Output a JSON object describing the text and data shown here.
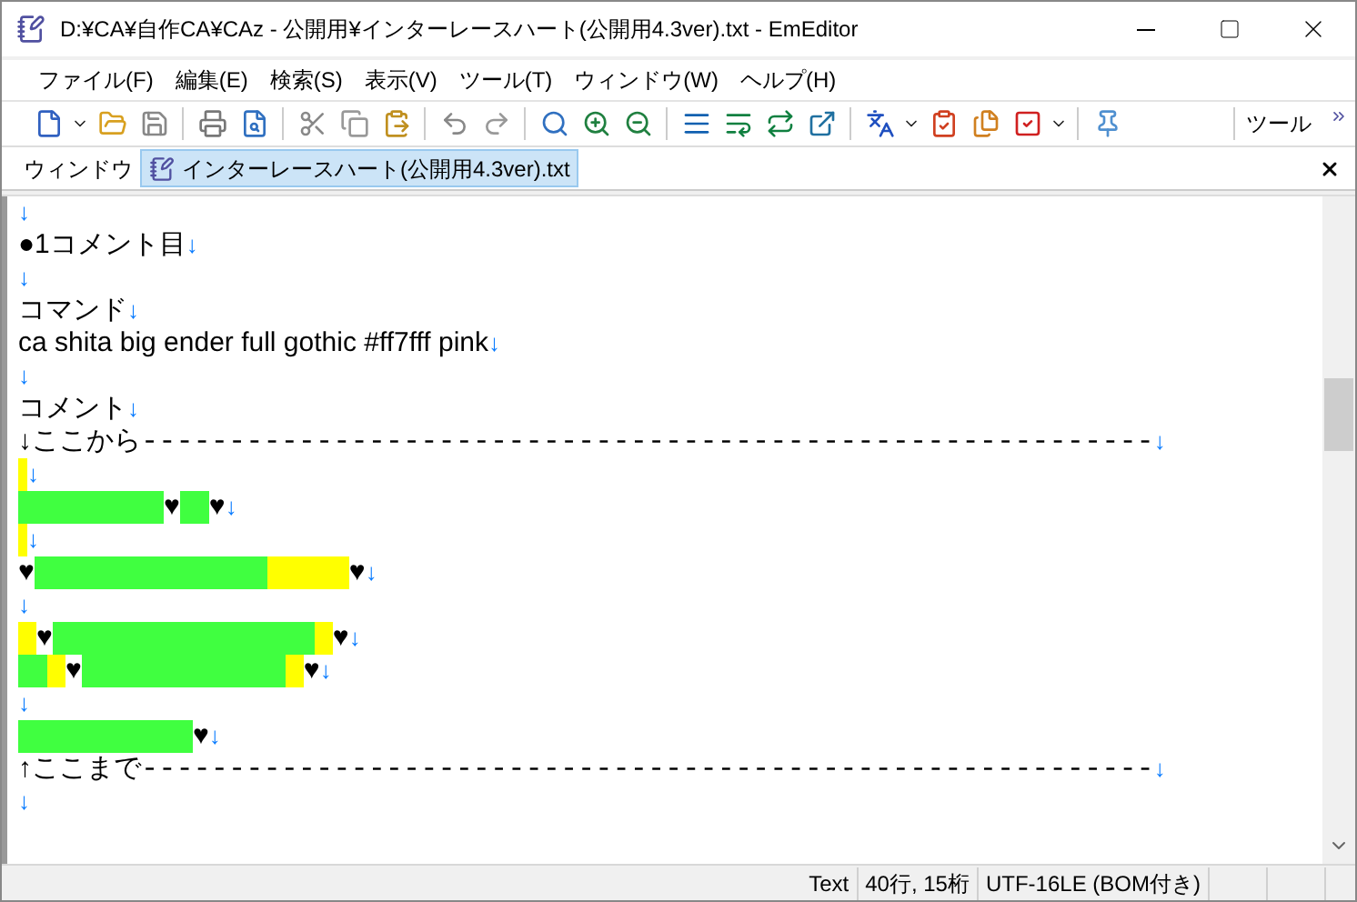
{
  "window": {
    "title": "D:¥CA¥自作CA¥CAz - 公開用¥インターレースハート(公開用4.3ver).txt - EmEditor"
  },
  "menu": [
    "ファイル(F)",
    "編集(E)",
    "検索(S)",
    "表示(V)",
    "ツール(T)",
    "ウィンドウ(W)",
    "ヘルプ(H)"
  ],
  "toolbar": {
    "overflow_label": "ツール"
  },
  "tabbar": {
    "label": "ウィンドウ",
    "tabs": [
      {
        "label": "インターレースハート(公開用4.3ver).txt",
        "selected": true
      }
    ]
  },
  "lines": [
    {
      "segments": [
        {
          "kind": "eol",
          "text": "↓"
        }
      ]
    },
    {
      "segments": [
        {
          "kind": "text",
          "text": "●1コメント目"
        },
        {
          "kind": "eol",
          "text": "↓"
        }
      ]
    },
    {
      "segments": [
        {
          "kind": "eol",
          "text": "↓"
        }
      ]
    },
    {
      "segments": [
        {
          "kind": "text",
          "text": "コマンド"
        },
        {
          "kind": "eol",
          "text": "↓"
        }
      ]
    },
    {
      "segments": [
        {
          "kind": "text",
          "text": "ca shita big ender full gothic #ff7fff pink"
        },
        {
          "kind": "eol",
          "text": "↓"
        }
      ]
    },
    {
      "segments": [
        {
          "kind": "eol",
          "text": "↓"
        }
      ]
    },
    {
      "segments": [
        {
          "kind": "text",
          "text": "コメント"
        },
        {
          "kind": "eol",
          "text": "↓"
        }
      ]
    },
    {
      "segments": [
        {
          "kind": "text",
          "text": "↓ここから"
        },
        {
          "kind": "rule",
          "text": "----------------------------------------------------------"
        },
        {
          "kind": "eol",
          "text": "↓"
        }
      ]
    },
    {
      "segments": [
        {
          "kind": "fill",
          "color": "#ffff00"
        },
        {
          "kind": "eol",
          "text": "↓"
        }
      ]
    },
    {
      "segments": [
        {
          "kind": "fill",
          "color": "#40ff40"
        },
        {
          "kind": "text",
          "text": "♥"
        },
        {
          "kind": "fill",
          "color": "#40ff40"
        },
        {
          "kind": "text",
          "text": "♥"
        },
        {
          "kind": "eol",
          "text": "↓"
        }
      ]
    },
    {
      "segments": [
        {
          "kind": "fill",
          "color": "#ffff00"
        },
        {
          "kind": "eol",
          "text": "↓"
        }
      ]
    },
    {
      "segments": [
        {
          "kind": "text",
          "text": "♥"
        },
        {
          "kind": "fill",
          "color": "#40ff40"
        },
        {
          "kind": "fill",
          "color": "#ffff00"
        },
        {
          "kind": "text",
          "text": "♥"
        },
        {
          "kind": "eol",
          "text": "↓"
        }
      ]
    },
    {
      "segments": [
        {
          "kind": "eol",
          "text": "↓"
        }
      ]
    },
    {
      "segments": [
        {
          "kind": "fill",
          "color": "#ffff00"
        },
        {
          "kind": "text",
          "text": "♥"
        },
        {
          "kind": "fill",
          "color": "#40ff40"
        },
        {
          "kind": "fill",
          "color": "#ffff00"
        },
        {
          "kind": "text",
          "text": "♥"
        },
        {
          "kind": "eol",
          "text": "↓"
        }
      ]
    },
    {
      "segments": [
        {
          "kind": "fill",
          "color": "#40ff40"
        },
        {
          "kind": "fill",
          "color": "#ffff00"
        },
        {
          "kind": "text",
          "text": "♥"
        },
        {
          "kind": "fill",
          "color": "#40ff40"
        },
        {
          "kind": "fill",
          "color": "#ffff00"
        },
        {
          "kind": "text",
          "text": "♥"
        },
        {
          "kind": "eol",
          "text": "↓"
        }
      ]
    },
    {
      "segments": [
        {
          "kind": "eol",
          "text": "↓"
        }
      ]
    },
    {
      "segments": [
        {
          "kind": "fill",
          "color": "#40ff40"
        },
        {
          "kind": "text",
          "text": "♥"
        },
        {
          "kind": "eol",
          "text": "↓"
        }
      ]
    },
    {
      "segments": [
        {
          "kind": "text",
          "text": "↑ここまで"
        },
        {
          "kind": "rule",
          "text": "----------------------------------------------------------"
        },
        {
          "kind": "eol",
          "text": "↓"
        }
      ]
    },
    {
      "segments": [
        {
          "kind": "eol",
          "text": "↓"
        }
      ]
    }
  ],
  "status_bar": [
    "Text",
    "40行, 15桁",
    "UTF-16LE (BOM付き)"
  ]
}
